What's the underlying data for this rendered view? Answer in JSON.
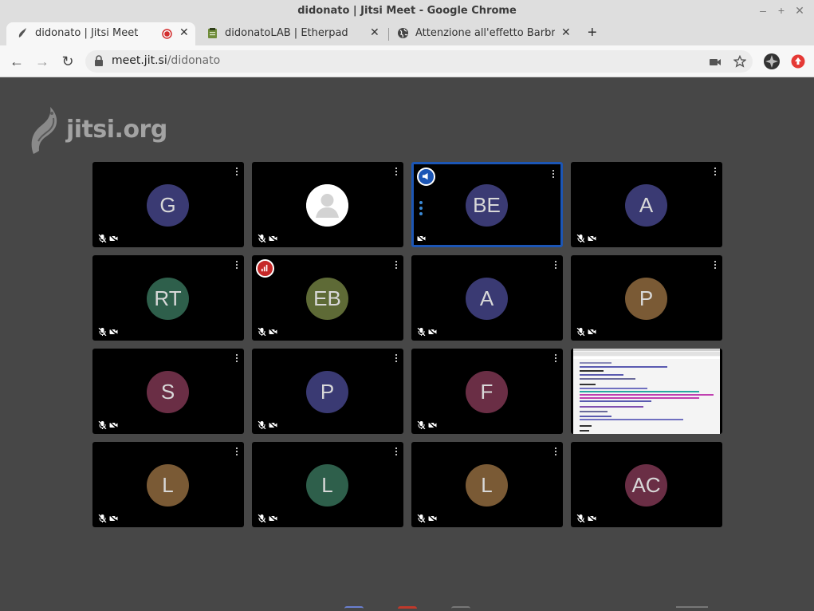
{
  "window": {
    "title": "didonato | Jitsi Meet - Google Chrome"
  },
  "tabs": [
    {
      "label": "didonato | Jitsi Meet",
      "active": true,
      "recording": true
    },
    {
      "label": "didonatoLAB | Etherpad",
      "active": false
    },
    {
      "label": "Attenzione all'effetto Barbra Str",
      "active": false
    }
  ],
  "toolbar": {
    "url_host": "meet.jit.si",
    "url_path": "/didonato"
  },
  "logo": {
    "text": "jitsi.org"
  },
  "participants": [
    {
      "initials": "G",
      "color": "#3a3a73",
      "avatar": "initials",
      "mic_muted": true,
      "cam_off": true
    },
    {
      "initials": "",
      "color": "#ffffff",
      "avatar": "default-user",
      "mic_muted": true,
      "cam_off": true
    },
    {
      "initials": "BE",
      "color": "#3a3a73",
      "avatar": "initials",
      "mic_muted": false,
      "cam_off": true,
      "active_speaker": true,
      "badge": "moderator-dominant"
    },
    {
      "initials": "A",
      "color": "#3a3a73",
      "avatar": "initials",
      "mic_muted": true,
      "cam_off": true
    },
    {
      "initials": "RT",
      "color": "#2e5f4b",
      "avatar": "initials",
      "mic_muted": true,
      "cam_off": true
    },
    {
      "initials": "EB",
      "color": "#5e6a36",
      "avatar": "initials",
      "mic_muted": true,
      "cam_off": true,
      "badge": "connection-poor"
    },
    {
      "initials": "A",
      "color": "#3a3a73",
      "avatar": "initials",
      "mic_muted": true,
      "cam_off": true
    },
    {
      "initials": "P",
      "color": "#7a5a35",
      "avatar": "initials",
      "mic_muted": true,
      "cam_off": true
    },
    {
      "initials": "S",
      "color": "#6a2e45",
      "avatar": "initials",
      "mic_muted": true,
      "cam_off": true
    },
    {
      "initials": "P",
      "color": "#3a3a73",
      "avatar": "initials",
      "mic_muted": true,
      "cam_off": true
    },
    {
      "initials": "F",
      "color": "#6a2e45",
      "avatar": "initials",
      "mic_muted": true,
      "cam_off": true
    },
    {
      "initials": "",
      "color": "#fafafa",
      "avatar": "screenshare",
      "mic_muted": false,
      "cam_off": false
    },
    {
      "initials": "L",
      "color": "#7a5a35",
      "avatar": "initials",
      "mic_muted": true,
      "cam_off": true
    },
    {
      "initials": "L",
      "color": "#2e5f4b",
      "avatar": "initials",
      "mic_muted": true,
      "cam_off": true
    },
    {
      "initials": "L",
      "color": "#7a5a35",
      "avatar": "initials",
      "mic_muted": true,
      "cam_off": true
    },
    {
      "initials": "AC",
      "color": "#6a2e45",
      "avatar": "initials",
      "mic_muted": true,
      "cam_off": true
    }
  ],
  "colors": {
    "page_bg": "#474747",
    "tile_bg": "#000000",
    "active_border": "#1c56b5",
    "record_red": "#d32f2f"
  }
}
